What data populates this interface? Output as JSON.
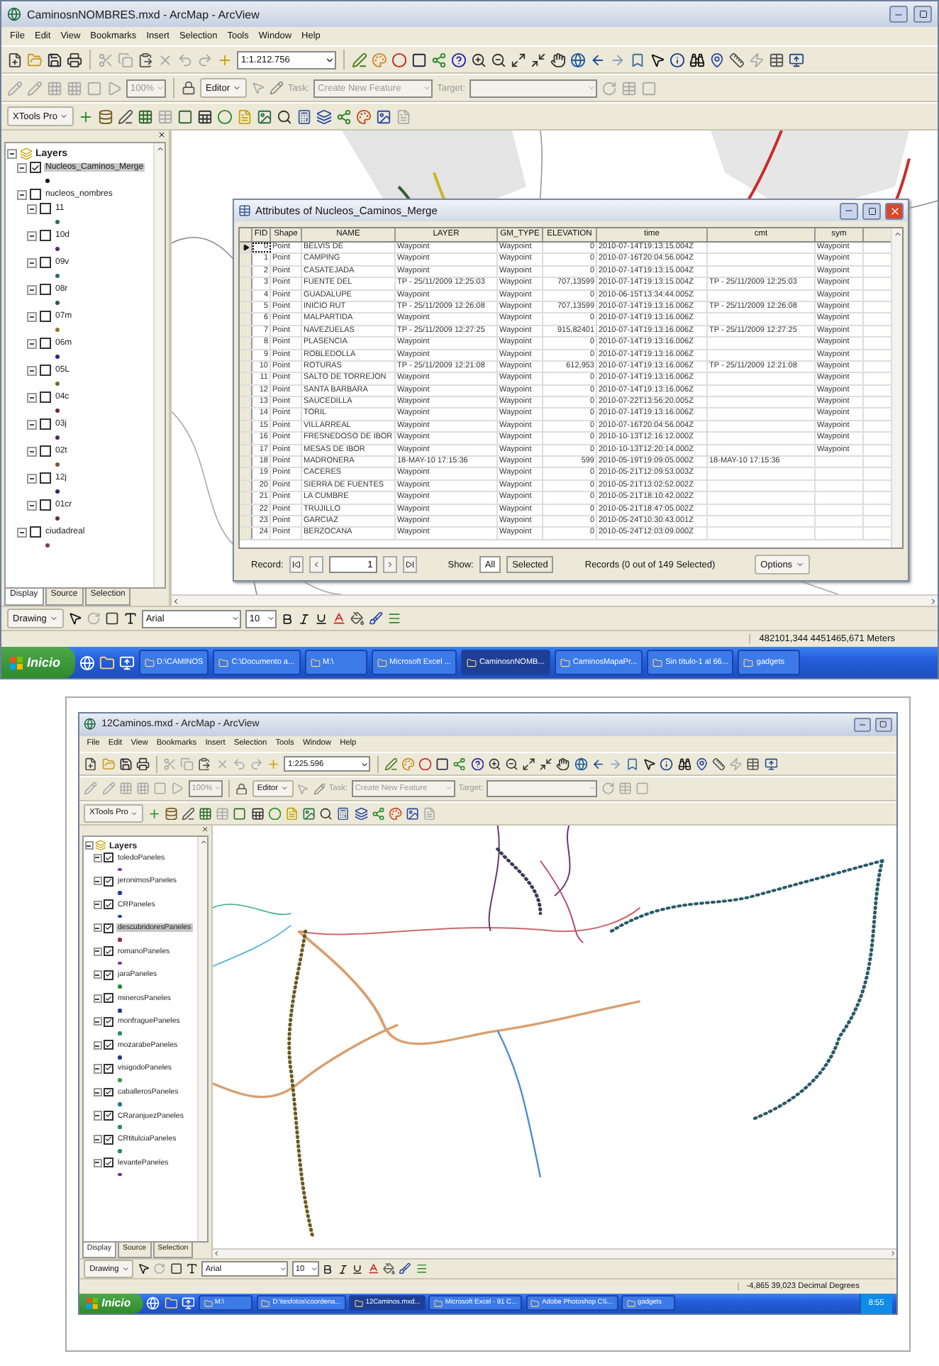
{
  "screens": [
    {
      "title": "CaminosnNOMBRES.mxd - ArcMap - ArcView",
      "menu": [
        "File",
        "Edit",
        "View",
        "Bookmarks",
        "Insert",
        "Selection",
        "Tools",
        "Window",
        "Help"
      ],
      "scale": "1:1.212.756",
      "zoom_percent": "100%",
      "editor": "Editor",
      "task_label": "Task:",
      "task_value": "Create New Feature",
      "target_label": "Target:",
      "xtools": "XTools Pro",
      "toc": {
        "root": "Layers",
        "items": [
          {
            "label": "Nucleos_Caminos_Merge",
            "checked": true,
            "selected": true,
            "color": "#111111"
          },
          {
            "label": "nucleos_nombres",
            "checked": false,
            "selected": false,
            "children": [
              {
                "label": "11",
                "checked": false,
                "selected": false,
                "color": "#2f6a4f"
              },
              {
                "label": "10d",
                "checked": false,
                "selected": false,
                "color": "#5a2a7a"
              },
              {
                "label": "09v",
                "checked": false,
                "selected": false,
                "color": "#2a6a6a"
              },
              {
                "label": "08r",
                "checked": false,
                "selected": false,
                "color": "#285a40"
              },
              {
                "label": "07m",
                "checked": false,
                "selected": false,
                "color": "#8a7a30"
              },
              {
                "label": "06m",
                "checked": false,
                "selected": false,
                "color": "#2a2a7a"
              },
              {
                "label": "05L",
                "checked": false,
                "selected": false,
                "color": "#7a6a30"
              },
              {
                "label": "04c",
                "checked": false,
                "selected": false,
                "color": "#6a2a3a"
              },
              {
                "label": "03j",
                "checked": false,
                "selected": false,
                "color": "#4a2a6a"
              },
              {
                "label": "02t",
                "checked": false,
                "selected": false,
                "color": "#7a5a30"
              },
              {
                "label": "12j",
                "checked": false,
                "selected": false,
                "color": "#2a2a6a"
              },
              {
                "label": "01cr",
                "checked": false,
                "selected": false,
                "color": "#6a2a4a"
              }
            ]
          },
          {
            "label": "ciudadreal",
            "checked": false,
            "selected": false,
            "color": "#7a3a6a"
          }
        ],
        "tabs": [
          {
            "label": "Display",
            "selected": true
          },
          {
            "label": "Source",
            "selected": false
          },
          {
            "label": "Selection",
            "selected": false
          }
        ]
      },
      "drawing": "Drawing",
      "font": "Arial",
      "font_size": "10",
      "status": "482101,344  4451465,671 Meters",
      "taskbar": {
        "start": "Inicio",
        "items": [
          {
            "label": "D:\\CAMINOS",
            "selected": false
          },
          {
            "label": "C:\\Documento a...",
            "selected": false
          },
          {
            "label": "M:\\",
            "selected": false
          },
          {
            "label": "Microsoft Excel ...",
            "selected": false
          },
          {
            "label": "CaminosnNOMB...",
            "selected": true
          },
          {
            "label": "CaminosMapaPr...",
            "selected": false
          },
          {
            "label": "Sin título-1 al 66...",
            "selected": false
          },
          {
            "label": "gadgets",
            "selected": false
          }
        ]
      },
      "attributes": {
        "title": "Attributes of Nucleos_Caminos_Merge",
        "columns": [
          "FID",
          "Shape",
          "NAME",
          "LAYER",
          "GM_TYPE",
          "ELEVATION",
          "time",
          "cmt",
          "sym"
        ],
        "rows": [
          {
            "fid": "0",
            "shape": "Point",
            "name": "BELVIS DE",
            "layer": "Waypoint",
            "gm_type": "Waypoint",
            "elevation": "0",
            "time": "2010-07-14T19:13:15.004Z",
            "sym": "Waypoint",
            "current": true
          },
          {
            "fid": "1",
            "shape": "Point",
            "name": "CAMPING",
            "layer": "Waypoint",
            "gm_type": "Waypoint",
            "elevation": "0",
            "time": "2010-07-16T20:04:56.004Z",
            "sym": "Waypoint",
            "current": false
          },
          {
            "fid": "2",
            "shape": "Point",
            "name": "CASATEJADA",
            "layer": "Waypoint",
            "gm_type": "Waypoint",
            "elevation": "0",
            "time": "2010-07-14T19:13:15.004Z",
            "sym": "Waypoint",
            "current": false
          },
          {
            "fid": "3",
            "shape": "Point",
            "name": "FUENTE DEL",
            "layer": "TP - 25/11/2009 12:25:03",
            "gm_type": "Waypoint",
            "elevation": "707,13599",
            "time": "2010-07-14T19:13:15.004Z",
            "cmt": "TP - 25/11/2009 12:25:03",
            "sym": "Waypoint",
            "current": false
          },
          {
            "fid": "4",
            "shape": "Point",
            "name": "GUADALUPE",
            "layer": "Waypoint",
            "gm_type": "Waypoint",
            "elevation": "0",
            "time": "2010-06-15T13:34:44.005Z",
            "sym": "Waypoint",
            "current": false
          },
          {
            "fid": "5",
            "shape": "Point",
            "name": "INICIO RUT",
            "layer": "TP - 25/11/2009 12:26:08",
            "gm_type": "Waypoint",
            "elevation": "707,13599",
            "time": "2010-07-14T19:13:16.006Z",
            "cmt": "TP - 25/11/2009 12:26:08",
            "sym": "Waypoint",
            "current": false
          },
          {
            "fid": "6",
            "shape": "Point",
            "name": "MALPARTIDA",
            "layer": "Waypoint",
            "gm_type": "Waypoint",
            "elevation": "0",
            "time": "2010-07-14T19:13:16.006Z",
            "sym": "Waypoint",
            "current": false
          },
          {
            "fid": "7",
            "shape": "Point",
            "name": "NAVEZUELAS",
            "layer": "TP - 25/11/2009 12:27:25",
            "gm_type": "Waypoint",
            "elevation": "915,82401",
            "time": "2010-07-14T19:13:16.006Z",
            "cmt": "TP - 25/11/2009 12:27:25",
            "sym": "Waypoint",
            "current": false
          },
          {
            "fid": "8",
            "shape": "Point",
            "name": "PLASENCIA",
            "layer": "Waypoint",
            "gm_type": "Waypoint",
            "elevation": "0",
            "time": "2010-07-14T19:13:16.006Z",
            "sym": "Waypoint",
            "current": false
          },
          {
            "fid": "9",
            "shape": "Point",
            "name": "ROBLEDOLLA",
            "layer": "Waypoint",
            "gm_type": "Waypoint",
            "elevation": "0",
            "time": "2010-07-14T19:13:16.006Z",
            "sym": "Waypoint",
            "current": false
          },
          {
            "fid": "10",
            "shape": "Point",
            "name": "ROTURAS",
            "layer": "TP - 25/11/2009 12:21:08",
            "gm_type": "Waypoint",
            "elevation": "612,953",
            "time": "2010-07-14T19:13:16.006Z",
            "cmt": "TP - 25/11/2009 12:21:08",
            "sym": "Waypoint",
            "current": false
          },
          {
            "fid": "11",
            "shape": "Point",
            "name": "SALTO DE TORREJON",
            "layer": "Waypoint",
            "gm_type": "Waypoint",
            "elevation": "0",
            "time": "2010-07-14T19:13:16.006Z",
            "sym": "Waypoint",
            "current": false
          },
          {
            "fid": "12",
            "shape": "Point",
            "name": "SANTA BARBARA",
            "layer": "Waypoint",
            "gm_type": "Waypoint",
            "elevation": "0",
            "time": "2010-07-14T19:13:16.006Z",
            "sym": "Waypoint",
            "current": false
          },
          {
            "fid": "13",
            "shape": "Point",
            "name": "SAUCEDILLA",
            "layer": "Waypoint",
            "gm_type": "Waypoint",
            "elevation": "0",
            "time": "2010-07-22T13:56:20.005Z",
            "sym": "Waypoint",
            "current": false
          },
          {
            "fid": "14",
            "shape": "Point",
            "name": "TORIL",
            "layer": "Waypoint",
            "gm_type": "Waypoint",
            "elevation": "0",
            "time": "2010-07-14T19:13:16.006Z",
            "sym": "Waypoint",
            "current": false
          },
          {
            "fid": "15",
            "shape": "Point",
            "name": "VILLARREAL",
            "layer": "Waypoint",
            "gm_type": "Waypoint",
            "elevation": "0",
            "time": "2010-07-16T20:04:56.004Z",
            "sym": "Waypoint",
            "current": false
          },
          {
            "fid": "16",
            "shape": "Point",
            "name": "FRESNEDOSO DE IBOR",
            "layer": "Waypoint",
            "gm_type": "Waypoint",
            "elevation": "0",
            "time": "2010-10-13T12:16:12.000Z",
            "sym": "Waypoint",
            "current": false
          },
          {
            "fid": "17",
            "shape": "Point",
            "name": "MESAS DE IBOR",
            "layer": "Waypoint",
            "gm_type": "Waypoint",
            "elevation": "0",
            "time": "2010-10-13T12:20:14.000Z",
            "sym": "Waypoint",
            "current": false
          },
          {
            "fid": "18",
            "shape": "Point",
            "name": "MADRONERA",
            "layer": "18-MAY-10 17:15:36",
            "gm_type": "Waypoint",
            "elevation": "599",
            "time": "2010-05-19T19:09:05.000Z",
            "cmt": "18-MAY-10 17:15:36",
            "current": false
          },
          {
            "fid": "19",
            "shape": "Point",
            "name": "CACERES",
            "layer": "Waypoint",
            "gm_type": "Waypoint",
            "elevation": "0",
            "time": "2010-05-21T12:09:53.003Z",
            "current": false
          },
          {
            "fid": "20",
            "shape": "Point",
            "name": "SIERRA DE FUENTES",
            "layer": "Waypoint",
            "gm_type": "Waypoint",
            "elevation": "0",
            "time": "2010-05-21T13:02:52.002Z",
            "current": false
          },
          {
            "fid": "21",
            "shape": "Point",
            "name": "LA CUMBRE",
            "layer": "Waypoint",
            "gm_type": "Waypoint",
            "elevation": "0",
            "time": "2010-05-21T18:10:42.002Z",
            "current": false
          },
          {
            "fid": "22",
            "shape": "Point",
            "name": "TRUJILLO",
            "layer": "Waypoint",
            "gm_type": "Waypoint",
            "elevation": "0",
            "time": "2010-05-21T18:47:05.002Z",
            "current": false
          },
          {
            "fid": "23",
            "shape": "Point",
            "name": "GARCIAZ",
            "layer": "Waypoint",
            "gm_type": "Waypoint",
            "elevation": "0",
            "time": "2010-05-24T10:30:43.001Z",
            "current": false
          },
          {
            "fid": "24",
            "shape": "Point",
            "name": "BERZOCANA",
            "layer": "Waypoint",
            "gm_type": "Waypoint",
            "elevation": "0",
            "time": "2010-05-24T12:03:09.000Z",
            "current": false
          }
        ],
        "record_label": "Record:",
        "record_value": "1",
        "show_label": "Show:",
        "show_buttons": [
          {
            "label": "All",
            "selected": true
          },
          {
            "label": "Selected",
            "selected": false
          }
        ],
        "records_text": "Records (0 out of 149 Selected)",
        "options": "Options"
      }
    },
    {
      "title": "12Caminos.mxd - ArcMap - ArcView",
      "menu": [
        "File",
        "Edit",
        "View",
        "Bookmarks",
        "Insert",
        "Selection",
        "Tools",
        "Window",
        "Help"
      ],
      "scale": "1:225.596",
      "zoom_percent": "100%",
      "editor": "Editor",
      "task_label": "Task:",
      "task_value": "Create New Feature",
      "target_label": "Target:",
      "xtools": "XTools Pro",
      "toc": {
        "root": "Layers",
        "items": [
          {
            "label": "toledoPaneles",
            "checked": true,
            "selected": false,
            "color": "#7a3a9a"
          },
          {
            "label": "jeronimosPaneles",
            "checked": true,
            "selected": false,
            "color": "#2a3a9a"
          },
          {
            "label": "CRPaneles",
            "checked": true,
            "selected": false,
            "color": "#2a3aa0"
          },
          {
            "label": "descubridoresPaneles",
            "checked": true,
            "selected": true,
            "color": "#9a2a4a"
          },
          {
            "label": "romanoPaneles",
            "checked": true,
            "selected": false,
            "color": "#6a3a9a"
          },
          {
            "label": "jaraPaneles",
            "checked": true,
            "selected": false,
            "color": "#2a8a3a"
          },
          {
            "label": "minerosPaneles",
            "checked": true,
            "selected": false,
            "color": "#2a3a8a"
          },
          {
            "label": "monfraguePaneles",
            "checked": true,
            "selected": false,
            "color": "#2a8a7a"
          },
          {
            "label": "mozarabePaneles",
            "checked": true,
            "selected": false,
            "color": "#2a3a8c"
          },
          {
            "label": "visigodoPaneles",
            "checked": true,
            "selected": false,
            "color": "#3a9a3a"
          },
          {
            "label": "caballerosPaneles",
            "checked": true,
            "selected": false,
            "color": "#2a7a8a"
          },
          {
            "label": "CRaranjuezPaneles",
            "checked": true,
            "selected": false,
            "color": "#2a8a6a"
          },
          {
            "label": "CRtitulciaPaneles",
            "checked": true,
            "selected": false,
            "color": "#2a8a6c"
          },
          {
            "label": "levantePaneles",
            "checked": true,
            "selected": false,
            "color": "#6a2a8a"
          }
        ],
        "tabs": [
          {
            "label": "Display",
            "selected": true
          },
          {
            "label": "Source",
            "selected": false
          },
          {
            "label": "Selection",
            "selected": false
          }
        ]
      },
      "drawing": "Drawing",
      "font": "Arial",
      "font_size": "10",
      "status": "-4,865  39,023 Decimal Degrees",
      "taskbar": {
        "start": "Inicio",
        "clock": "8:55",
        "items": [
          {
            "label": "M:\\",
            "selected": false
          },
          {
            "label": "D:\\tesfotos\\coordena...",
            "selected": false
          },
          {
            "label": "12Caminos.mxd...",
            "selected": true
          },
          {
            "label": "Microsoft Excel - 91 C...",
            "selected": false
          },
          {
            "label": "Adobe Photoshop CS...",
            "selected": false
          },
          {
            "label": "gadgets",
            "selected": false
          }
        ]
      }
    }
  ]
}
